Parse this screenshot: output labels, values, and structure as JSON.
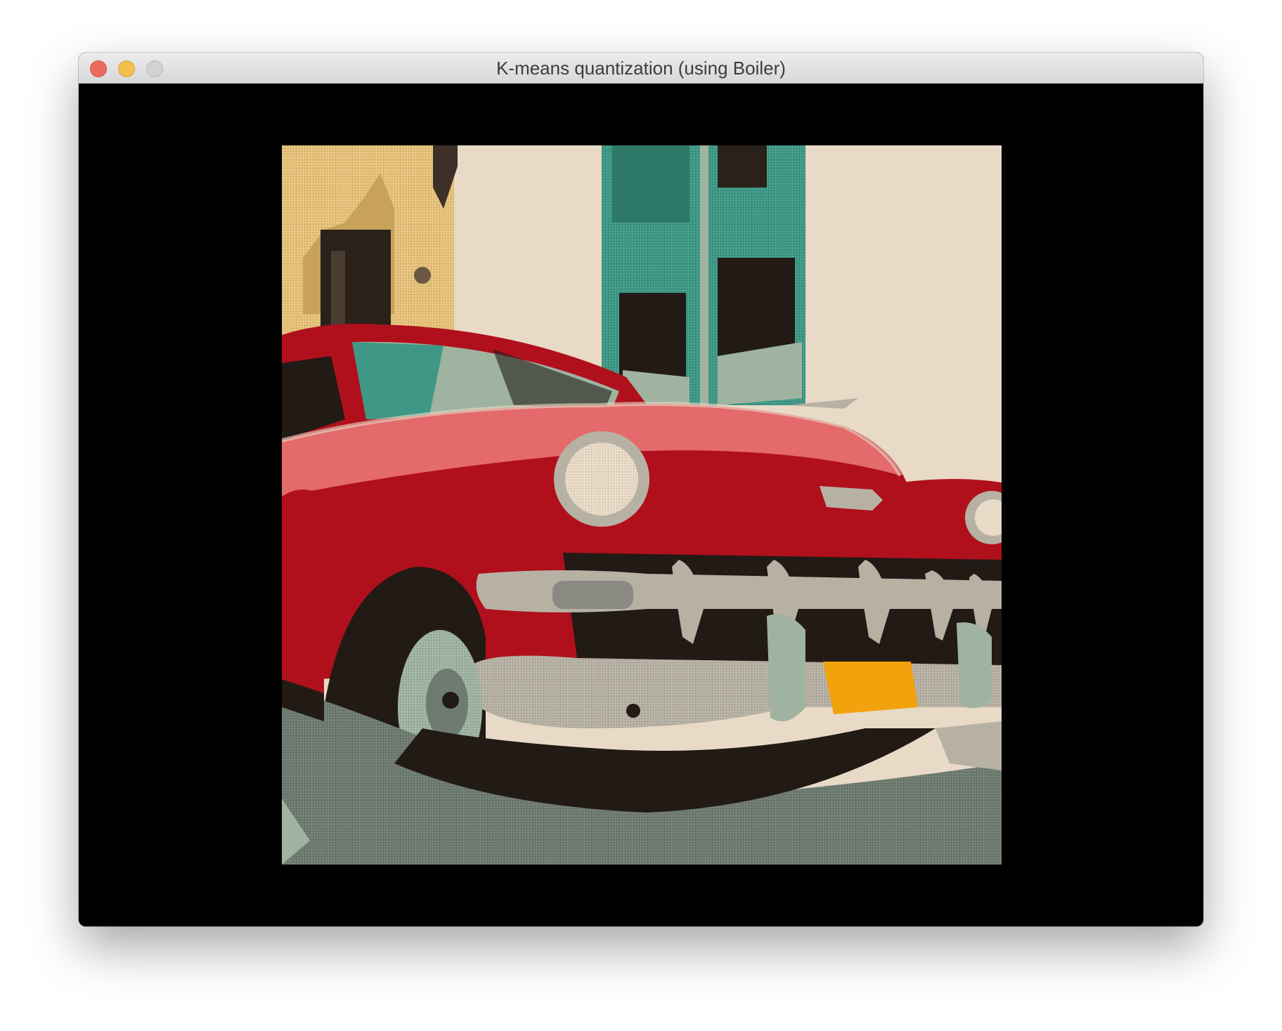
{
  "window": {
    "title": "K-means quantization (using Boiler)",
    "controls": [
      "close",
      "minimize",
      "zoom"
    ]
  },
  "canvas": {
    "background": "#000000",
    "image_description_icon": "quantized-photo-classic-red-car",
    "palette": {
      "cream": "#e8dac6",
      "wall_yellow": "#e6c27a",
      "teal": "#3f9886",
      "sage": "#9fb3a0",
      "red": "#b0101c",
      "pink": "#e46a6c",
      "dark": "#221a15",
      "chrome": "#b7b1a4",
      "plate": "#f2a20c",
      "gray": "#6e7b70"
    }
  }
}
